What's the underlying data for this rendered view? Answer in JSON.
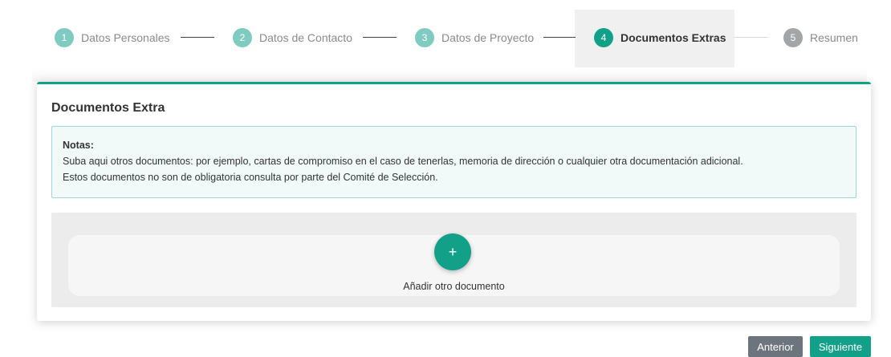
{
  "stepper": {
    "steps": [
      {
        "number": "1",
        "label": "Datos Personales",
        "state": "done"
      },
      {
        "number": "2",
        "label": "Datos de Contacto",
        "state": "done"
      },
      {
        "number": "3",
        "label": "Datos de Proyecto",
        "state": "done"
      },
      {
        "number": "4",
        "label": "Documentos Extras",
        "state": "active"
      },
      {
        "number": "5",
        "label": "Resumen",
        "state": "disabled"
      }
    ]
  },
  "card": {
    "title": "Documentos Extra",
    "notes": {
      "title": "Notas:",
      "line1": "Suba aqui otros documentos: por ejemplo, cartas de compromiso en el caso de tenerlas, memoria de dirección o cualquier otra documentación adicional.",
      "line2": "Estos documentos no son de obligatoria consulta por parte del Comité de Selección."
    },
    "upload": {
      "add_icon": "+",
      "add_label": "Añadir otro documento"
    }
  },
  "footer": {
    "prev_label": "Anterior",
    "next_label": "Siguiente"
  },
  "colors": {
    "accent": "#12a188",
    "accent_light": "#7fcbc0",
    "disabled": "#a3a6a9",
    "notes_bg": "#f2f9f9",
    "secondary_button": "#6c757d"
  }
}
